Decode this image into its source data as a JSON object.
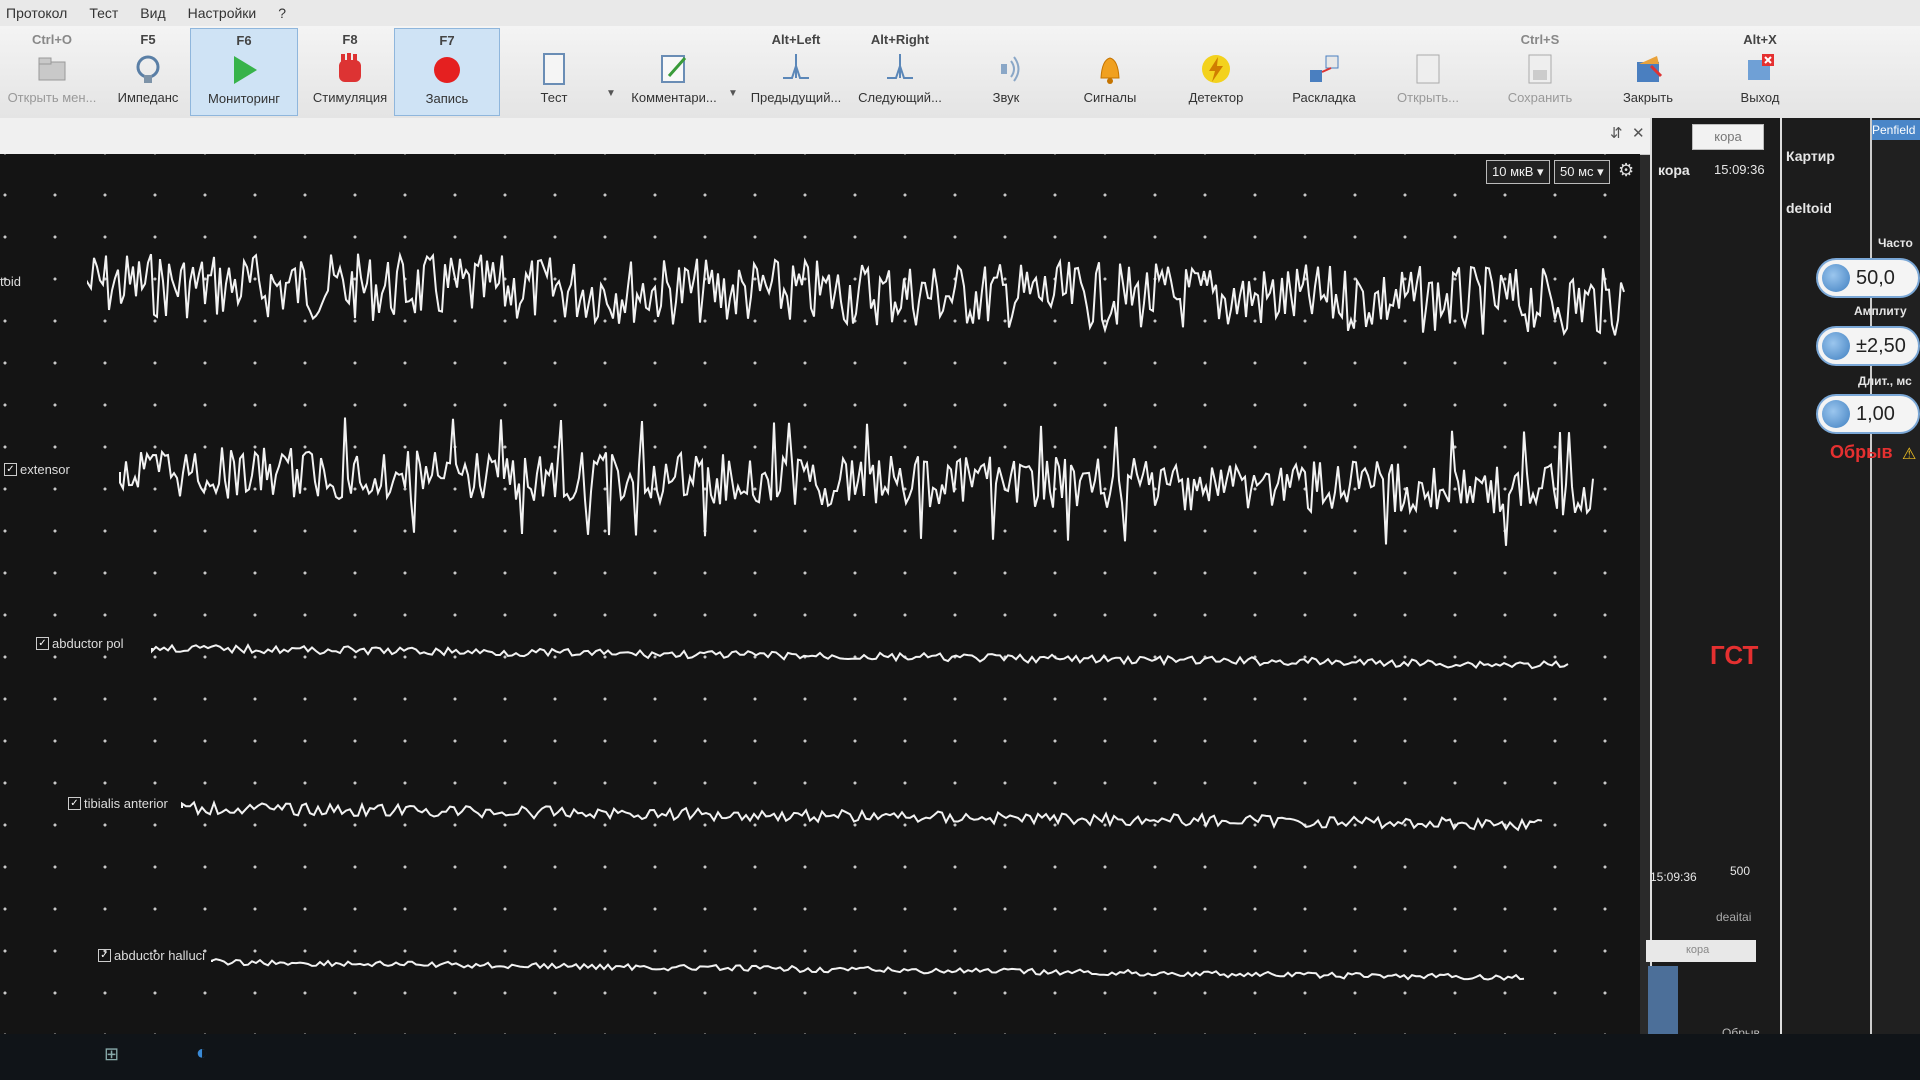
{
  "menu": [
    "Протокол",
    "Тест",
    "Вид",
    "Настройки",
    "?"
  ],
  "toolbar": [
    {
      "key": "Ctrl+O",
      "label": "Открыть мен...",
      "icon": "folder-icon",
      "dim": true
    },
    {
      "key": "F5",
      "label": "Импеданс",
      "icon": "impedance-icon",
      "dim": false
    },
    {
      "key": "F6",
      "label": "Мониторинг",
      "icon": "play-icon",
      "active": true
    },
    {
      "key": "F8",
      "label": "Стимуляция",
      "icon": "stimulation-hand-icon"
    },
    {
      "key": "F7",
      "label": "Запись",
      "icon": "record-icon",
      "active": true
    },
    {
      "key": "",
      "label": "Тест",
      "icon": "test-icon"
    },
    {
      "key": "",
      "label": "Комментари...",
      "icon": "comment-icon"
    },
    {
      "key": "Alt+Left",
      "label": "Предыдущий...",
      "icon": "previous-icon"
    },
    {
      "key": "Alt+Right",
      "label": "Следующий...",
      "icon": "next-icon"
    },
    {
      "key": "",
      "label": "Звук",
      "icon": "sound-icon"
    },
    {
      "key": "",
      "label": "Сигналы",
      "icon": "bell-icon"
    },
    {
      "key": "",
      "label": "Детектор",
      "icon": "lightning-icon"
    },
    {
      "key": "",
      "label": "Раскладка",
      "icon": "layout-icon"
    },
    {
      "key": "",
      "label": "Открыть...",
      "icon": "open-icon",
      "dim": true
    },
    {
      "key": "Ctrl+S",
      "label": "Сохранить",
      "icon": "save-icon",
      "dim": true
    },
    {
      "key": "",
      "label": "Закрыть",
      "icon": "close-doc-icon"
    },
    {
      "key": "Alt+X",
      "label": "Выход",
      "icon": "exit-icon"
    }
  ],
  "emg": {
    "sensitivity": "10 мкВ",
    "timebase": "50 мс",
    "channels": [
      {
        "label": "toid",
        "checked": false
      },
      {
        "label": "extensor",
        "checked": true
      },
      {
        "label": "abductor pol",
        "checked": true
      },
      {
        "label": "tibialis anterior",
        "checked": true
      },
      {
        "label": "abductor halluci",
        "checked": true
      }
    ]
  },
  "panel_kora": {
    "tab": "кора",
    "title": "кора",
    "time": "15:09:36",
    "bottom_time": "15:09:36",
    "bottom_scale": "500",
    "bottom_label": "deaitai",
    "mini_tab": "кора",
    "status": "Обрыв"
  },
  "panel_mapping": {
    "title": "Картир",
    "channel": "deltoid",
    "alarm_text": "ГСТ"
  },
  "panel_stim": {
    "tab": "Penfield",
    "freq_label": "Часто",
    "freq_value": "50,0",
    "amp_label": "Амплиту",
    "amp_value": "±2,50",
    "dur_label": "Длит., мс",
    "dur_value": "1,00",
    "status": "Обрыв"
  },
  "colors": {
    "trace": "#f2f2f2",
    "record": "#e52020",
    "status_red": "#e53030",
    "active_bg": "#cfe3f5"
  }
}
